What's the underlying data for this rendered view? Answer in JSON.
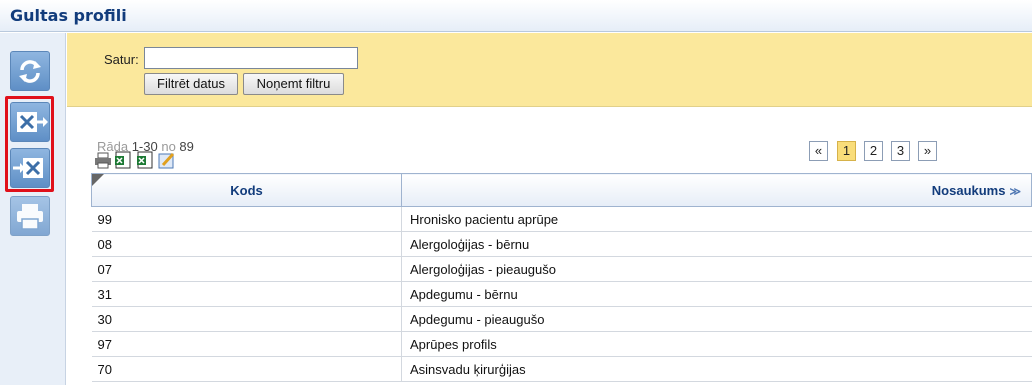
{
  "window": {
    "title": "Gultas profili"
  },
  "toolbar": {
    "buttons": [
      {
        "name": "refresh-icon"
      },
      {
        "name": "export-excel-icon"
      },
      {
        "name": "import-excel-icon"
      },
      {
        "name": "print-icon"
      }
    ],
    "highlight_color": "#e0101a"
  },
  "filter": {
    "label": "Satur:",
    "input_value": "",
    "filter_button": "Filtrēt datus",
    "clear_button": "Noņemt filtru"
  },
  "grid": {
    "info_prefix": "Rāda ",
    "info_range": "1-30",
    "info_mid": " no ",
    "info_total": "89",
    "pager": [
      "«",
      "1",
      "2",
      "3",
      "»"
    ],
    "current_page": "1",
    "columns": [
      "Kods",
      "Nosaukums"
    ],
    "rows": [
      {
        "kods": "99",
        "nosaukums": "Hronisko pacientu aprūpe"
      },
      {
        "kods": "08",
        "nosaukums": "Alergoloģijas - bērnu"
      },
      {
        "kods": "07",
        "nosaukums": "Alergoloģijas - pieaugušo"
      },
      {
        "kods": "31",
        "nosaukums": "Apdegumu - bērnu"
      },
      {
        "kods": "30",
        "nosaukums": "Apdegumu - pieaugušo"
      },
      {
        "kods": "97",
        "nosaukums": "Aprūpes profils"
      },
      {
        "kods": "70",
        "nosaukums": "Asinsvadu ķirurģijas"
      }
    ]
  },
  "colors": {
    "title": "#123c7c",
    "filter_bg": "#fbe89c",
    "active_page": "#f9dd7a"
  }
}
